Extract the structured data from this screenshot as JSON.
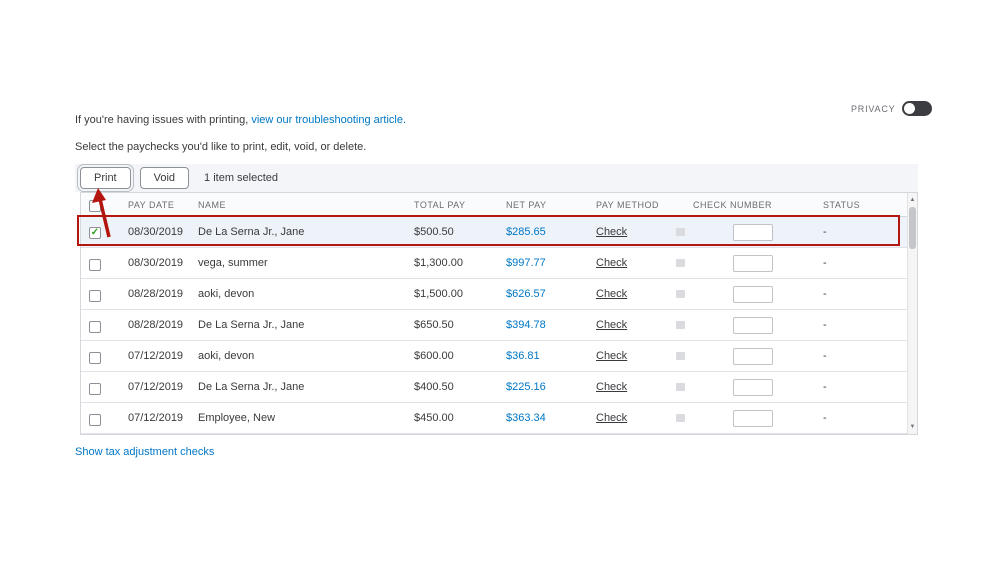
{
  "privacy": {
    "label": "PRIVACY"
  },
  "intro": {
    "prefix": "If you're having issues with printing, ",
    "link": "view our troubleshooting article."
  },
  "instruction": "Select the paychecks you'd like to print, edit, void, or delete.",
  "toolbar": {
    "print": "Print",
    "void": "Void",
    "selection_status": "1 item selected"
  },
  "table": {
    "headers": [
      "PAY DATE",
      "NAME",
      "TOTAL PAY",
      "NET PAY",
      "PAY METHOD",
      "CHECK NUMBER",
      "STATUS"
    ],
    "rows": [
      {
        "selected": true,
        "pay_date": "08/30/2019",
        "name": "De La Serna Jr., Jane",
        "total_pay": "$500.50",
        "net_pay": "$285.65",
        "pay_method": "Check",
        "check_number": "",
        "status": "-"
      },
      {
        "selected": false,
        "pay_date": "08/30/2019",
        "name": "vega, summer",
        "total_pay": "$1,300.00",
        "net_pay": "$997.77",
        "pay_method": "Check",
        "check_number": "",
        "status": "-"
      },
      {
        "selected": false,
        "pay_date": "08/28/2019",
        "name": "aoki, devon",
        "total_pay": "$1,500.00",
        "net_pay": "$626.57",
        "pay_method": "Check",
        "check_number": "",
        "status": "-"
      },
      {
        "selected": false,
        "pay_date": "08/28/2019",
        "name": "De La Serna Jr., Jane",
        "total_pay": "$650.50",
        "net_pay": "$394.78",
        "pay_method": "Check",
        "check_number": "",
        "status": "-"
      },
      {
        "selected": false,
        "pay_date": "07/12/2019",
        "name": "aoki, devon",
        "total_pay": "$600.00",
        "net_pay": "$36.81",
        "pay_method": "Check",
        "check_number": "",
        "status": "-"
      },
      {
        "selected": false,
        "pay_date": "07/12/2019",
        "name": "De La Serna Jr., Jane",
        "total_pay": "$400.50",
        "net_pay": "$225.16",
        "pay_method": "Check",
        "check_number": "",
        "status": "-"
      },
      {
        "selected": false,
        "pay_date": "07/12/2019",
        "name": "Employee, New",
        "total_pay": "$450.00",
        "net_pay": "$363.34",
        "pay_method": "Check",
        "check_number": "",
        "status": "-"
      }
    ]
  },
  "footer": {
    "link": "Show tax adjustment checks"
  },
  "icons": {
    "checkmark": "✓",
    "scroll_up": "▲",
    "scroll_down": "▼"
  },
  "colors": {
    "link_blue": "#0077c5",
    "amount_blue": "#0077c5",
    "annotation_red": "#b3150f",
    "selected_row_bg": "#eef2f9",
    "check_green": "#2ca01c",
    "toolbar_bg": "#f4f5f8"
  }
}
